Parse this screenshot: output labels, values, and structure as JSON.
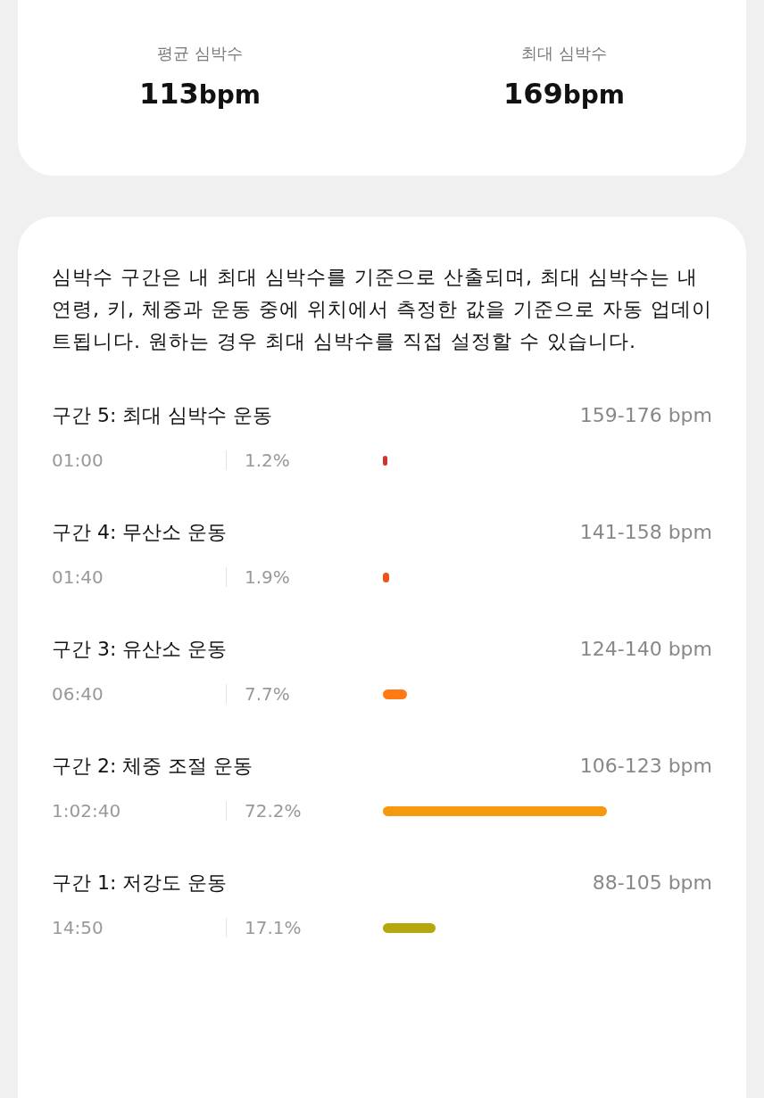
{
  "summary": [
    {
      "label": "평균 심박수",
      "value": "113",
      "unit": "bpm"
    },
    {
      "label": "최대 심박수",
      "value": "169",
      "unit": "bpm"
    }
  ],
  "description": "심박수 구간은 내 최대 심박수를 기준으로 산출되며, 최대 심박수는 내 연령, 키, 체중과 운동 중에 위치에서 측정한 값을 기준으로 자동 업데이트됩니다. 원하는 경우 최대 심박수를 직접 설정할 수 있습니다.",
  "zones": [
    {
      "title": "구간 5: 최대 심박수 운동",
      "range": "159-176 bpm",
      "time": "01:00",
      "percent": "1.2%",
      "color": "#d0342c"
    },
    {
      "title": "구간 4: 무산소 운동",
      "range": "141-158 bpm",
      "time": "01:40",
      "percent": "1.9%",
      "color": "#f0521c"
    },
    {
      "title": "구간 3: 유산소 운동",
      "range": "124-140 bpm",
      "time": "06:40",
      "percent": "7.7%",
      "color": "#ff7a14"
    },
    {
      "title": "구간 2: 체중 조절 운동",
      "range": "106-123 bpm",
      "time": "1:02:40",
      "percent": "72.2%",
      "color": "#f5990f"
    },
    {
      "title": "구간 1: 저강도 운동",
      "range": "88-105 bpm",
      "time": "14:50",
      "percent": "17.1%",
      "color": "#b5a80f"
    }
  ]
}
